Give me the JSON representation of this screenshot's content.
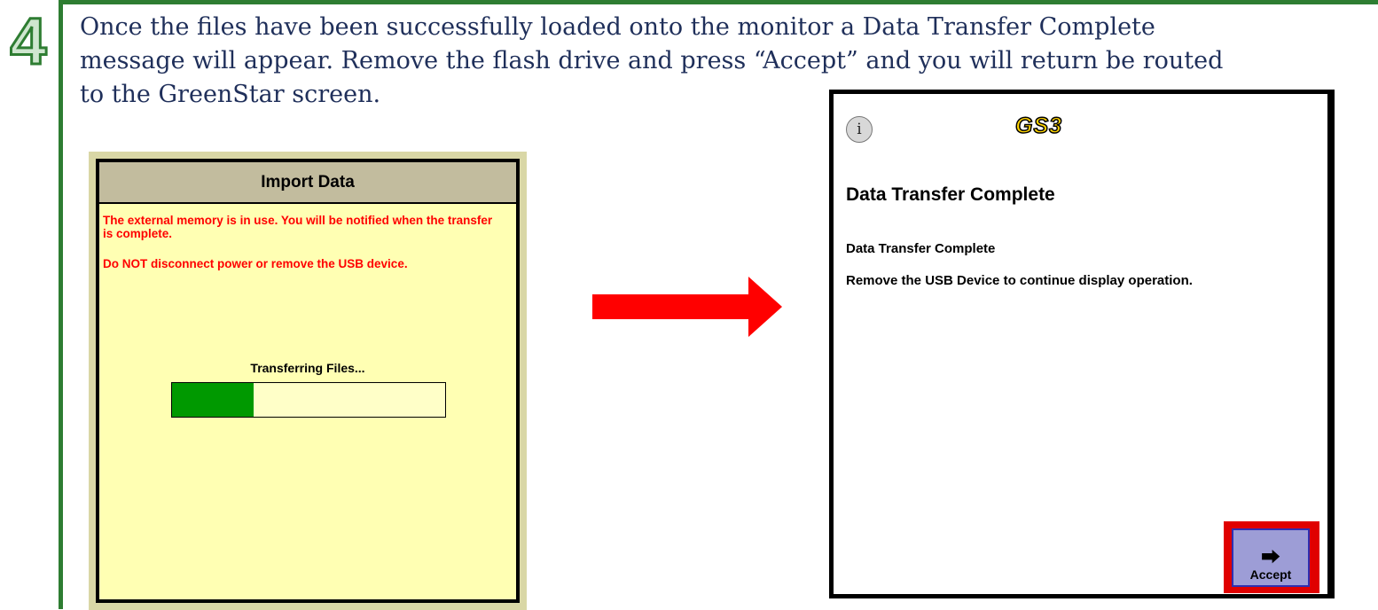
{
  "step": {
    "number": "4"
  },
  "instruction": "Once the files have been successfully loaded onto the monitor a Data Transfer Complete message will appear.  Remove the flash drive and press “Accept” and you will return be routed to the GreenStar screen.",
  "import_dialog": {
    "title": "Import Data",
    "message_1": "The external memory is in use.  You will be notified when the transfer is complete.",
    "message_2": "Do NOT disconnect power or remove the USB device.",
    "progress_label": "Transferring Files...",
    "progress_fraction": 0.3
  },
  "complete_screen": {
    "logo": "GS3",
    "info_icon": "info-icon",
    "heading": "Data Transfer Complete",
    "line_1": "Data Transfer Complete",
    "line_2": "Remove the USB Device to continue display operation.",
    "accept_label": "Accept",
    "accept_icon": "arrow-right-diamond-icon"
  },
  "colors": {
    "rule_green": "#2e7d32",
    "warning_red": "#ff0000",
    "progress_green": "#009900",
    "highlight_red": "#e00000",
    "arrow_red": "#ff0000"
  }
}
